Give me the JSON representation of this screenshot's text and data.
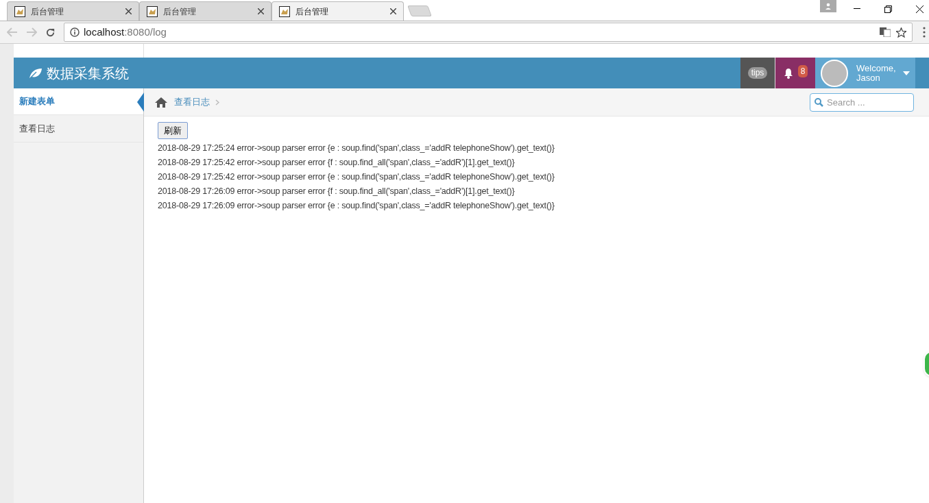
{
  "browser": {
    "tabs": [
      {
        "title": "后台管理",
        "selected": false
      },
      {
        "title": "后台管理",
        "selected": false
      },
      {
        "title": "后台管理",
        "selected": true
      }
    ],
    "url_host": "localhost",
    "url_rest": ":8080/log"
  },
  "navbar": {
    "brand": "数据采集系统",
    "tips": "tips",
    "notification_count": "8",
    "welcome": "Welcome,",
    "user": "Jason"
  },
  "sidebar": {
    "items": [
      {
        "label": "新建表单",
        "selected": true
      },
      {
        "label": "查看日志",
        "selected": false
      }
    ]
  },
  "breadcrumb": [
    "查看日志"
  ],
  "search": {
    "placeholder": "Search ..."
  },
  "refresh_button": "刷新",
  "log_lines": [
    "2018-08-29 17:25:24 error->soup parser error {e : soup.find('span',class_='addR telephoneShow').get_text()}",
    "2018-08-29 17:25:42 error->soup parser error {f : soup.find_all('span',class_='addR')[1].get_text()}",
    "2018-08-29 17:25:42 error->soup parser error {e : soup.find('span',class_='addR telephoneShow').get_text()}",
    "2018-08-29 17:26:09 error->soup parser error {f : soup.find_all('span',class_='addR')[1].get_text()}",
    "2018-08-29 17:26:09 error->soup parser error {e : soup.find('span',class_='addR telephoneShow').get_text()}"
  ]
}
